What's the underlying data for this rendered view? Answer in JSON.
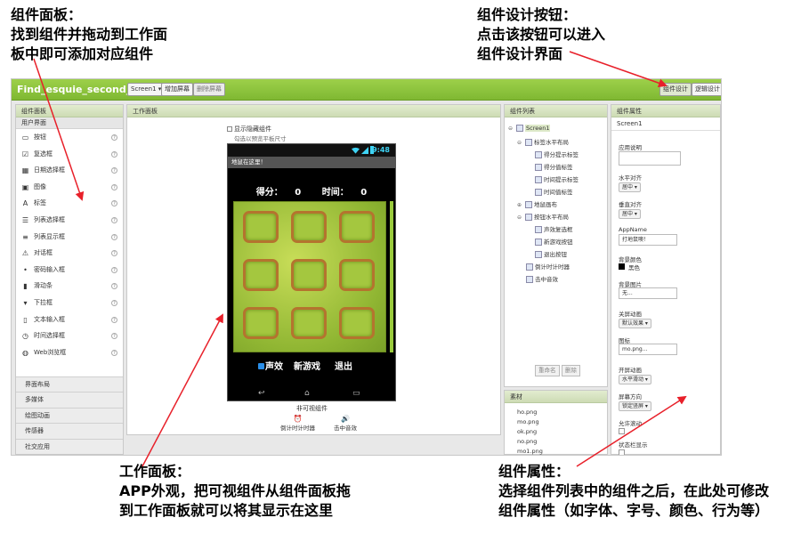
{
  "annotations": {
    "palette": {
      "line1": "组件面板：",
      "line2": "找到组件并拖动到工作面",
      "line3": "板中即可添加对应组件"
    },
    "design_button": {
      "line1": "组件设计按钮：",
      "line2": "点击该按钮可以进入",
      "line3": "组件设计界面"
    },
    "viewer": {
      "line1": "工作面板：",
      "line2": "APP外观，把可视组件从组件面板拖",
      "line3": "到工作面板就可以将其显示在这里"
    },
    "properties": {
      "line1": "组件属性：",
      "line2": "选择组件列表中的组件之后，在此处可修改",
      "line3": "组件属性（如字体、字号、颜色、行为等）"
    }
  },
  "topbar": {
    "project_name": "Find_esquie_second_0",
    "screen_select": "Screen1 ▾",
    "add_screen": "增加屏幕",
    "remove_screen": "删除屏幕",
    "designer": "组件设计",
    "blocks": "逻辑设计"
  },
  "palette": {
    "title": "组件面板",
    "section": "用户界面",
    "items": [
      {
        "label": "按钮",
        "icon": "button-icon"
      },
      {
        "label": "复选框",
        "icon": "checkbox-icon"
      },
      {
        "label": "日期选择框",
        "icon": "date-picker-icon"
      },
      {
        "label": "图像",
        "icon": "image-icon"
      },
      {
        "label": "标签",
        "icon": "label-icon"
      },
      {
        "label": "列表选择框",
        "icon": "list-picker-icon"
      },
      {
        "label": "列表显示框",
        "icon": "list-view-icon"
      },
      {
        "label": "对话框",
        "icon": "notifier-icon"
      },
      {
        "label": "密码输入框",
        "icon": "password-icon"
      },
      {
        "label": "滑动条",
        "icon": "slider-icon"
      },
      {
        "label": "下拉框",
        "icon": "spinner-icon"
      },
      {
        "label": "文本输入框",
        "icon": "textbox-icon"
      },
      {
        "label": "时间选择框",
        "icon": "time-picker-icon"
      },
      {
        "label": "Web浏览框",
        "icon": "web-viewer-icon"
      }
    ],
    "categories": [
      "界面布局",
      "多媒体",
      "绘图动画",
      "传感器",
      "社交应用"
    ]
  },
  "viewer": {
    "title": "工作面板",
    "show_hidden": "显示隐藏组件",
    "tablet_preview": "勾选以预览平板尺寸",
    "phone": {
      "clock": "9:48",
      "app_title": "地鼠在这里！",
      "score_label": "得分：",
      "score_value": "0",
      "time_label": "时间：",
      "time_value": "0",
      "sound_label": "声效",
      "new_game": "新游戏",
      "quit": "退出"
    },
    "nonvisible_title": "非可视组件",
    "nonvisible": {
      "timer": "倒计时计时器",
      "sound": "击中音效"
    }
  },
  "components": {
    "title": "组件列表",
    "tree": {
      "screen1": "Screen1",
      "h_arrangement1": "标签水平布局",
      "score_prompt": "得分提示标签",
      "score_value": "得分值标签",
      "time_prompt": "时间提示标签",
      "time_value": "时间值标签",
      "canvas": "地鼠画布",
      "h_arrangement2": "按钮水平布局",
      "sound_check": "声效复选框",
      "new_game_btn": "新游戏按钮",
      "quit_btn": "退出按钮",
      "timer": "倒计时计时器",
      "hit_sound": "击中音效"
    },
    "rename": "重命名",
    "delete": "删除"
  },
  "media": {
    "title": "素材",
    "files": [
      "ho.png",
      "mo.png",
      "ok.png",
      "no.png",
      "mo1.png"
    ]
  },
  "properties": {
    "title": "组件属性",
    "screen": "Screen1",
    "about_label": "应用说明",
    "h_align_label": "水平对齐",
    "h_align_value": "居中 ▾",
    "v_align_label": "垂直对齐",
    "v_align_value": "居中 ▾",
    "appname_label": "AppName",
    "appname_value": "打地鼠噢！",
    "bg_color_label": "背景颜色",
    "bg_color_value": "黑色",
    "bg_image_label": "背景图片",
    "bg_image_value": "无...",
    "close_anim_label": "关屏动画",
    "close_anim_value": "默认效果 ▾",
    "icon_label": "图标",
    "icon_value": "mo.png...",
    "open_anim_label": "开屏动画",
    "open_anim_value": "水平滑动 ▾",
    "orientation_label": "屏幕方向",
    "orientation_value": "锁定竖屏 ▾",
    "scrollable_label": "允许滚动",
    "statusbar_label": "状态栏显示"
  },
  "colors": {
    "topbar": "#8dc63f",
    "arrow": "#e8202a",
    "panel_header": "#d4e2bc"
  }
}
